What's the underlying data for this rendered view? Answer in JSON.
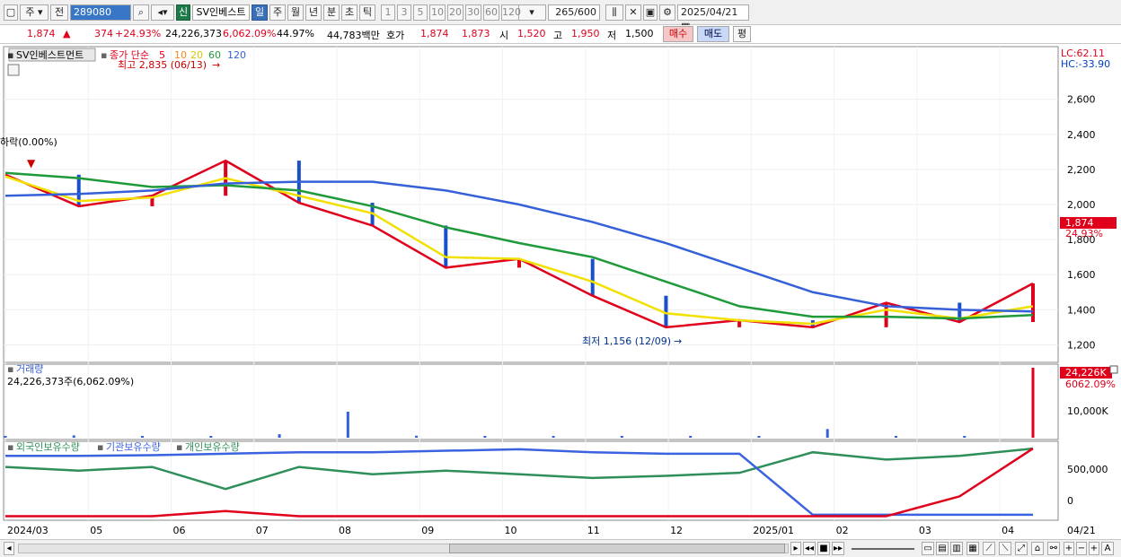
{
  "toolbar": {
    "period_label": "주",
    "prev_label": "전",
    "stock_code": "289080",
    "new_label": "신",
    "stock_name": "SV인베스트",
    "timeframes": [
      "일",
      "주",
      "월",
      "년",
      "분",
      "초",
      "틱"
    ],
    "intervals": [
      "1",
      "3",
      "5",
      "10",
      "20",
      "30",
      "60",
      "120"
    ],
    "count": "265",
    "count_total": "/600",
    "date": "2025/04/21"
  },
  "quote": {
    "price": "1,874",
    "change": "374",
    "change_pct": "+24.93%",
    "volume": "24,226,373",
    "volume_pct": "6,062.09%",
    "turnover_pct": "44.97%",
    "amount": "44,783백만",
    "bid_label": "호가",
    "bid1": "1,874",
    "bid2": "1,873",
    "open_label": "시",
    "open": "1,520",
    "high_label": "고",
    "high": "1,950",
    "low_label": "저",
    "low": "1,500",
    "buy_label": "매수",
    "sell_label": "매도",
    "avg_label": "평"
  },
  "price_panel": {
    "title": "SV인베스트먼트",
    "ma_label": "종가 단순",
    "ma_periods": [
      "5",
      "10",
      "20",
      "60",
      "120"
    ],
    "max_annotation": "최고 2,835 (06/13)",
    "min_annotation": "최저 1,156 (12/09)",
    "drop_annotation": "하락(0.00%)",
    "lc_label": "LC:62.11",
    "hc_label": "HC:-33.90",
    "last_price": "1,874",
    "last_pct": "24.93%",
    "y_ticks": [
      "2,600",
      "2,400",
      "2,200",
      "2,000",
      "1,800",
      "1,600",
      "1,400",
      "1,200"
    ]
  },
  "volume_panel": {
    "title": "거래량",
    "subtitle": "24,226,373주(6,062.09%)",
    "last_label": "24,226K",
    "last_pct": "6062.09%",
    "y_tick": "10,000K"
  },
  "holdings_panel": {
    "series_names": [
      "외국인보유수량",
      "기관보유수량",
      "개인보유수량"
    ],
    "y_ticks": [
      "500,000",
      "0"
    ]
  },
  "x_axis": {
    "labels": [
      "2024/03",
      "05",
      "06",
      "07",
      "08",
      "09",
      "10",
      "11",
      "12",
      "2025/01",
      "02",
      "03",
      "04"
    ],
    "right_label": "04/21"
  },
  "colors": {
    "ma5": "#e0001b",
    "ma10": "#f08a1e",
    "ma20": "#f2e000",
    "ma60": "#1f9a3a",
    "ma120": "#3560d8",
    "foreign": "#2f8f5a",
    "institution": "#3b63e0",
    "individual": "#e0001b"
  },
  "chart_data": {
    "type": "line",
    "title": "SV인베스트먼트",
    "x": [
      "2024/03",
      "2024/04",
      "2024/05",
      "2024/06",
      "2024/07",
      "2024/08",
      "2024/09",
      "2024/10",
      "2024/11",
      "2024/12",
      "2025/01",
      "2025/02",
      "2025/03",
      "2025/04",
      "2025/04/21"
    ],
    "series": [
      {
        "name": "5",
        "values": [
          2170,
          1990,
          2050,
          2250,
          2010,
          1880,
          1640,
          1690,
          1480,
          1300,
          1340,
          1300,
          1440,
          1330,
          1550
        ]
      },
      {
        "name": "20",
        "values": [
          2160,
          2020,
          2040,
          2150,
          2050,
          1950,
          1700,
          1690,
          1560,
          1380,
          1340,
          1320,
          1400,
          1350,
          1420
        ]
      },
      {
        "name": "60",
        "values": [
          2180,
          2150,
          2100,
          2110,
          2080,
          1990,
          1870,
          1780,
          1700,
          1560,
          1420,
          1360,
          1360,
          1350,
          1370
        ]
      },
      {
        "name": "120",
        "values": [
          2050,
          2060,
          2080,
          2120,
          2130,
          2130,
          2080,
          2000,
          1900,
          1780,
          1640,
          1500,
          1420,
          1400,
          1390
        ]
      }
    ],
    "ylim": [
      1100,
      2900
    ],
    "annotations": [
      "최고 2,835 (06/13)",
      "최저 1,156 (12/09)"
    ],
    "volume_k": [
      350,
      800,
      400,
      500,
      1200,
      9000,
      700,
      350,
      400,
      300,
      600,
      200,
      3000,
      250,
      150,
      24226
    ]
  }
}
